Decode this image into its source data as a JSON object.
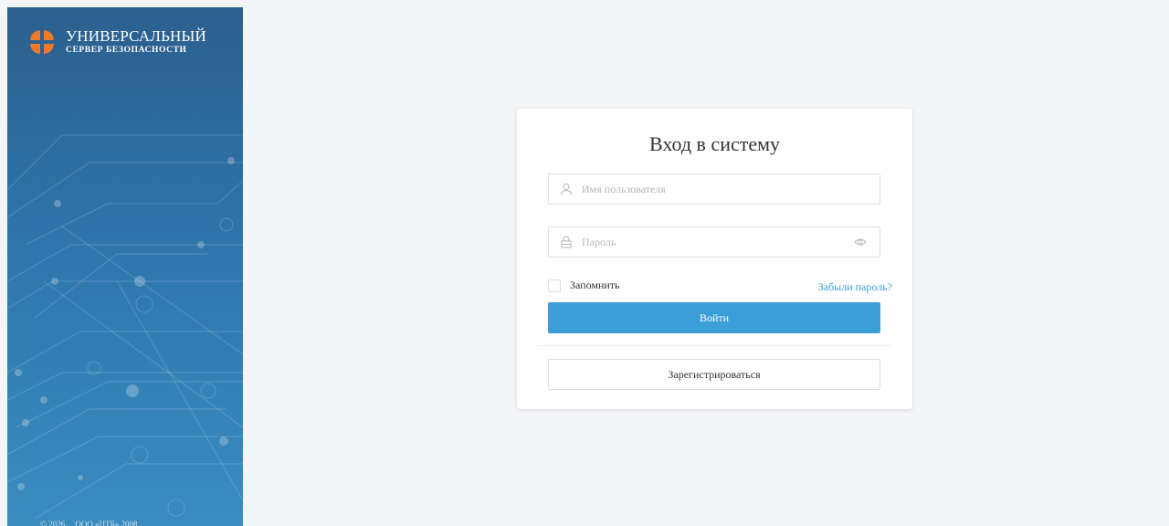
{
  "brand": {
    "title": "УНИВЕРСАЛЬНЫЙ",
    "subtitle": "СЕРВЕР БЕЗОПАСНОСТИ",
    "copyright": "© 2026 ... ООО «ЦТБ» 2008"
  },
  "login": {
    "title": "Вход в систему",
    "username_placeholder": "Имя пользователя",
    "username_value": "",
    "password_placeholder": "Пароль",
    "password_value": "",
    "remember_label": "Запомнить",
    "remember_checked": false,
    "forgot_label": "Забыли пароль?",
    "submit_label": "Войти",
    "register_label": "Зарегистрироваться"
  },
  "colors": {
    "accent": "#3a9fd6",
    "sidebar": "#2f78ad",
    "logo": "#f07a2a"
  },
  "icons": {
    "username": "user-icon",
    "password": "lock-icon",
    "toggle": "eye-icon"
  }
}
